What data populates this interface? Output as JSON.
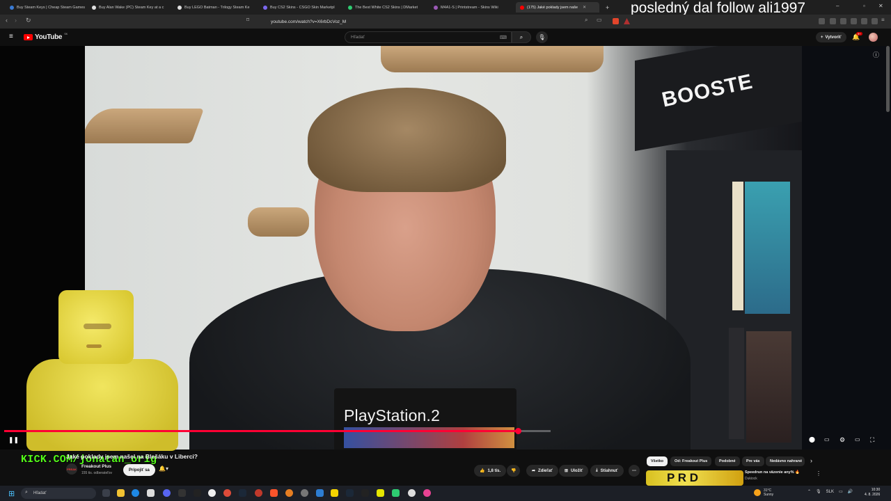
{
  "overlay_text": "posledný dal follow ali1997",
  "browser": {
    "tabs": [
      {
        "title": "Buy Steam Keys | Cheap Steam Games",
        "color": "#3a7bd5"
      },
      {
        "title": "Buy Alan Wake (PC) Steam Key at a c",
        "color": "#f5f5f5"
      },
      {
        "title": "Buy LEGO Batman - Trilogy Steam Ke",
        "color": "#f5f5f5"
      },
      {
        "title": "Buy CS2 Skins - CSGO Skin Marketpl",
        "color": "#7b68ee"
      },
      {
        "title": "The Best White CS2 Skins | DMarket",
        "color": "#2ecc71"
      },
      {
        "title": "M4A1-S | Printstream - Skins Wiki",
        "color": "#9b59b6"
      },
      {
        "title": "(175) Jaké poklady jsem naše",
        "color": "#ff0000"
      }
    ],
    "url": "youtube.com/watch?v=X6rbDcVoz_M"
  },
  "youtube": {
    "logo_text": "YouTube",
    "logo_region": "SK",
    "search_placeholder": "Hľadať",
    "create_label": "Vytvoriť",
    "notification_count": "9+"
  },
  "player": {
    "progress_fraction": 0.94,
    "ps2_label": "PlayStation.2",
    "booster_text": "BOOSTE"
  },
  "kick_text": "KICK.COM/jonatan_orig",
  "video": {
    "title": "Jaké poklady jsem našel na Blešáku v Liberci?",
    "channel_name": "Freakout Plus",
    "subscribers": "155 tis. odberateľov",
    "join_label": "Pripojiť sa",
    "likes": "1,8 tis.",
    "share_label": "Zdieľať",
    "save_label": "Uložiť",
    "download_label": "Stiahnuť"
  },
  "chips": [
    "Všetko",
    "Od: Freakout Plus",
    "Podobné",
    "Pre vás",
    "Nedávno nahrané"
  ],
  "recommendation": {
    "thumb_text": "P R D",
    "title": "Speedrun na väzenie any% 🔥",
    "channel": "Dukiock"
  },
  "taskbar": {
    "search_label": "Hľadať",
    "weather_temp": "31°C",
    "weather_desc": "Sunny",
    "language": "SLK",
    "time": "10:30",
    "date": "4. 8. 2026"
  }
}
